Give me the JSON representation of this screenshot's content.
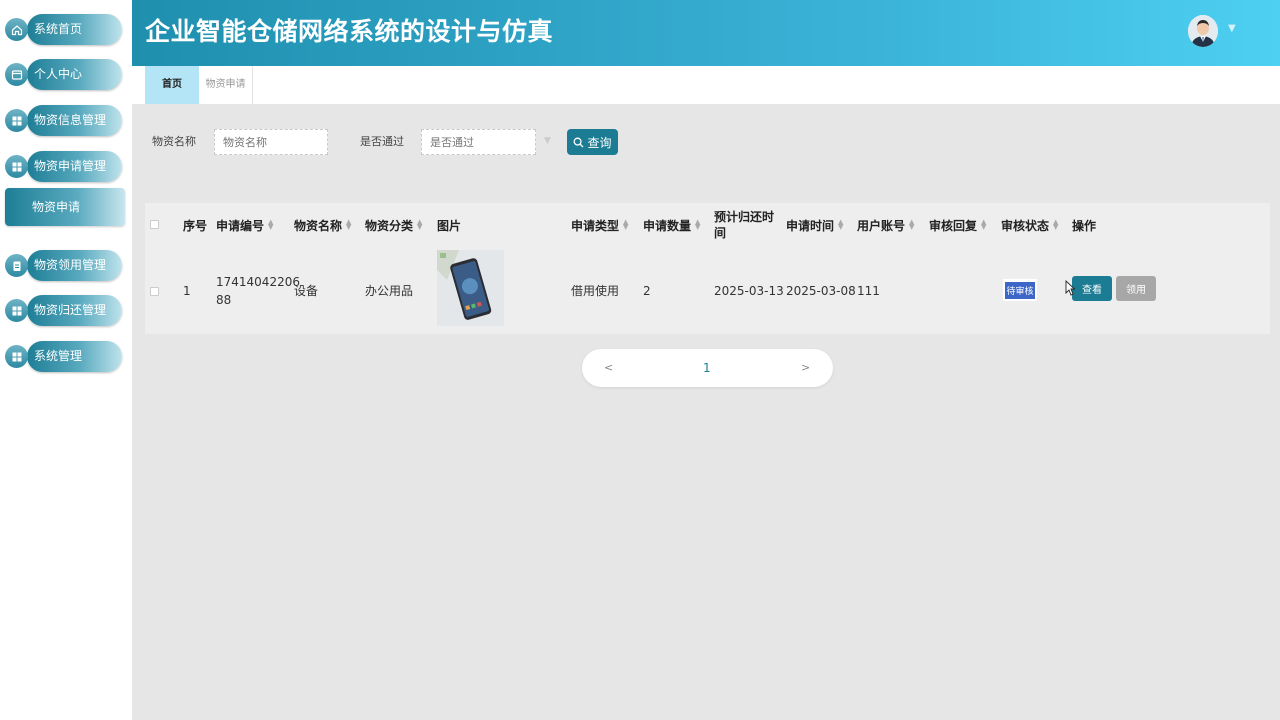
{
  "app": {
    "title": "企业智能仓储网络系统的设计与仿真"
  },
  "sidebar": {
    "items": [
      {
        "label": "系统首页",
        "icon": "home-icon"
      },
      {
        "label": "个人中心",
        "icon": "profile-card-icon"
      },
      {
        "label": "物资信息管理",
        "icon": "grid-icon"
      },
      {
        "label": "物资申请管理",
        "icon": "grid-icon"
      },
      {
        "label": "物资领用管理",
        "icon": "clipboard-icon"
      },
      {
        "label": "物资归还管理",
        "icon": "grid-icon"
      },
      {
        "label": "系统管理",
        "icon": "grid-icon"
      }
    ],
    "active_sub": {
      "label": "物资申请"
    }
  },
  "tabs": [
    {
      "label": "首页"
    },
    {
      "label": "物资申请"
    }
  ],
  "search": {
    "name_label": "物资名称",
    "name_placeholder": "物资名称",
    "pass_label": "是否通过",
    "pass_placeholder": "是否通过",
    "button_label": "查询"
  },
  "table": {
    "columns": [
      "序号",
      "申请编号",
      "物资名称",
      "物资分类",
      "图片",
      "申请类型",
      "申请数量",
      "预计归还时间",
      "申请时间",
      "用户账号",
      "审核回复",
      "审核状态",
      "操作"
    ],
    "rows": [
      {
        "index": "1",
        "code_line1": "17414042206",
        "code_line2": "88",
        "name": "设备",
        "category": "办公用品",
        "type": "借用使用",
        "quantity": "2",
        "return_date": "2025-03-13",
        "apply_date": "2025-03-08",
        "account": "111",
        "reply": "",
        "status": "待审核",
        "view_label": "查看",
        "receive_label": "领用"
      }
    ]
  },
  "pagination": {
    "prev": "<",
    "current": "1",
    "next": ">"
  },
  "colors": {
    "accent": "#1b7c93",
    "header_start": "#1f8fae",
    "header_end": "#4dd0f2",
    "status_badge": "#3c67c9"
  }
}
